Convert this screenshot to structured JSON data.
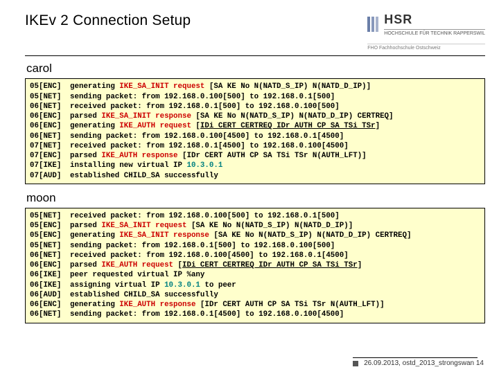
{
  "header": {
    "title": "IKEv 2 Connection Setup",
    "logo": {
      "hsr": "HSR",
      "sub": "HOCHSCHULE FÜR TECHNIK RAPPERSWIL",
      "fho": "FHO Fachhochschule Ostschweiz"
    }
  },
  "hosts": {
    "carol": {
      "label": "carol",
      "lines": [
        {
          "tag": "05[ENC]",
          "segs": [
            {
              "t": "generating "
            },
            {
              "t": "IKE_SA_INIT request",
              "c": "red"
            },
            {
              "t": " [SA KE No N(NATD_S_IP) N(NATD_D_IP)]"
            }
          ]
        },
        {
          "tag": "05[NET]",
          "segs": [
            {
              "t": "sending packet: from 192.168.0.100[500] to 192.168.0.1[500]"
            }
          ]
        },
        {
          "tag": "06[NET]",
          "segs": [
            {
              "t": "received packet: from 192.168.0.1[500] to 192.168.0.100[500]"
            }
          ]
        },
        {
          "tag": "06[ENC]",
          "segs": [
            {
              "t": "parsed "
            },
            {
              "t": "IKE_SA_INIT response",
              "c": "red"
            },
            {
              "t": " [SA KE No N(NATD_S_IP) N(NATD_D_IP) CERTREQ]"
            }
          ]
        },
        {
          "tag": "06[ENC]",
          "segs": [
            {
              "t": "generating "
            },
            {
              "t": "IKE_AUTH request",
              "c": "red"
            },
            {
              "t": " ["
            },
            {
              "t": "IDi CERT CERTREQ IDr AUTH CP SA TSi TSr",
              "c": "u"
            },
            {
              "t": "]"
            }
          ]
        },
        {
          "tag": "06[NET]",
          "segs": [
            {
              "t": "sending packet: from 192.168.0.100[4500] to 192.168.0.1[4500]"
            }
          ]
        },
        {
          "tag": "07[NET]",
          "segs": [
            {
              "t": "received packet: from 192.168.0.1[4500] to 192.168.0.100[4500]"
            }
          ]
        },
        {
          "tag": "07[ENC]",
          "segs": [
            {
              "t": "parsed "
            },
            {
              "t": "IKE_AUTH response ",
              "c": "red"
            },
            {
              "t": "[IDr CERT AUTH CP SA TSi TSr N(AUTH_LFT)]"
            }
          ]
        },
        {
          "tag": "07[IKE]",
          "segs": [
            {
              "t": "installing new virtual IP "
            },
            {
              "t": "10.3.0.1",
              "c": "teal"
            }
          ]
        },
        {
          "tag": "07[AUD]",
          "segs": [
            {
              "t": "established CHILD_SA successfully"
            }
          ]
        }
      ]
    },
    "moon": {
      "label": "moon",
      "lines": [
        {
          "tag": "05[NET]",
          "segs": [
            {
              "t": "received packet: from 192.168.0.100[500] to 192.168.0.1[500]"
            }
          ]
        },
        {
          "tag": "05[ENC]",
          "segs": [
            {
              "t": "parsed "
            },
            {
              "t": "IKE_SA_INIT request",
              "c": "red"
            },
            {
              "t": " [SA KE No N(NATD_S_IP) N(NATD_D_IP)]"
            }
          ]
        },
        {
          "tag": "05[ENC]",
          "segs": [
            {
              "t": "generating "
            },
            {
              "t": "IKE_SA_INIT response",
              "c": "red"
            },
            {
              "t": " [SA KE No N(NATD_S_IP) N(NATD_D_IP) CERTREQ]"
            }
          ]
        },
        {
          "tag": "05[NET]",
          "segs": [
            {
              "t": "sending packet: from 192.168.0.1[500] to 192.168.0.100[500]"
            }
          ]
        },
        {
          "tag": "06[NET]",
          "segs": [
            {
              "t": "received packet: from 192.168.0.100[4500] to 192.168.0.1[4500]"
            }
          ]
        },
        {
          "tag": "06[ENC]",
          "segs": [
            {
              "t": "parsed "
            },
            {
              "t": "IKE_AUTH request",
              "c": "red"
            },
            {
              "t": " ["
            },
            {
              "t": "IDi CERT CERTREQ IDr AUTH CP SA TSi TSr",
              "c": "u"
            },
            {
              "t": "]"
            }
          ]
        },
        {
          "tag": "06[IKE]",
          "segs": [
            {
              "t": "peer requested virtual IP %any"
            }
          ]
        },
        {
          "tag": "06[IKE]",
          "segs": [
            {
              "t": "assigning virtual IP "
            },
            {
              "t": "10.3.0.1",
              "c": "teal"
            },
            {
              "t": " to peer"
            }
          ]
        },
        {
          "tag": "06[AUD]",
          "segs": [
            {
              "t": "established CHILD_SA successfully"
            }
          ]
        },
        {
          "tag": "06[ENC]",
          "segs": [
            {
              "t": "generating "
            },
            {
              "t": "IKE_AUTH response",
              "c": "red"
            },
            {
              "t": " [IDr CERT AUTH CP SA TSi TSr N(AUTH_LFT)]"
            }
          ]
        },
        {
          "tag": "06[NET]",
          "segs": [
            {
              "t": "sending packet: from 192.168.0.1[4500] to 192.168.0.100[4500]"
            }
          ]
        }
      ]
    }
  },
  "footer": {
    "text": "26.09.2013, ostd_2013_strongswan 14"
  }
}
